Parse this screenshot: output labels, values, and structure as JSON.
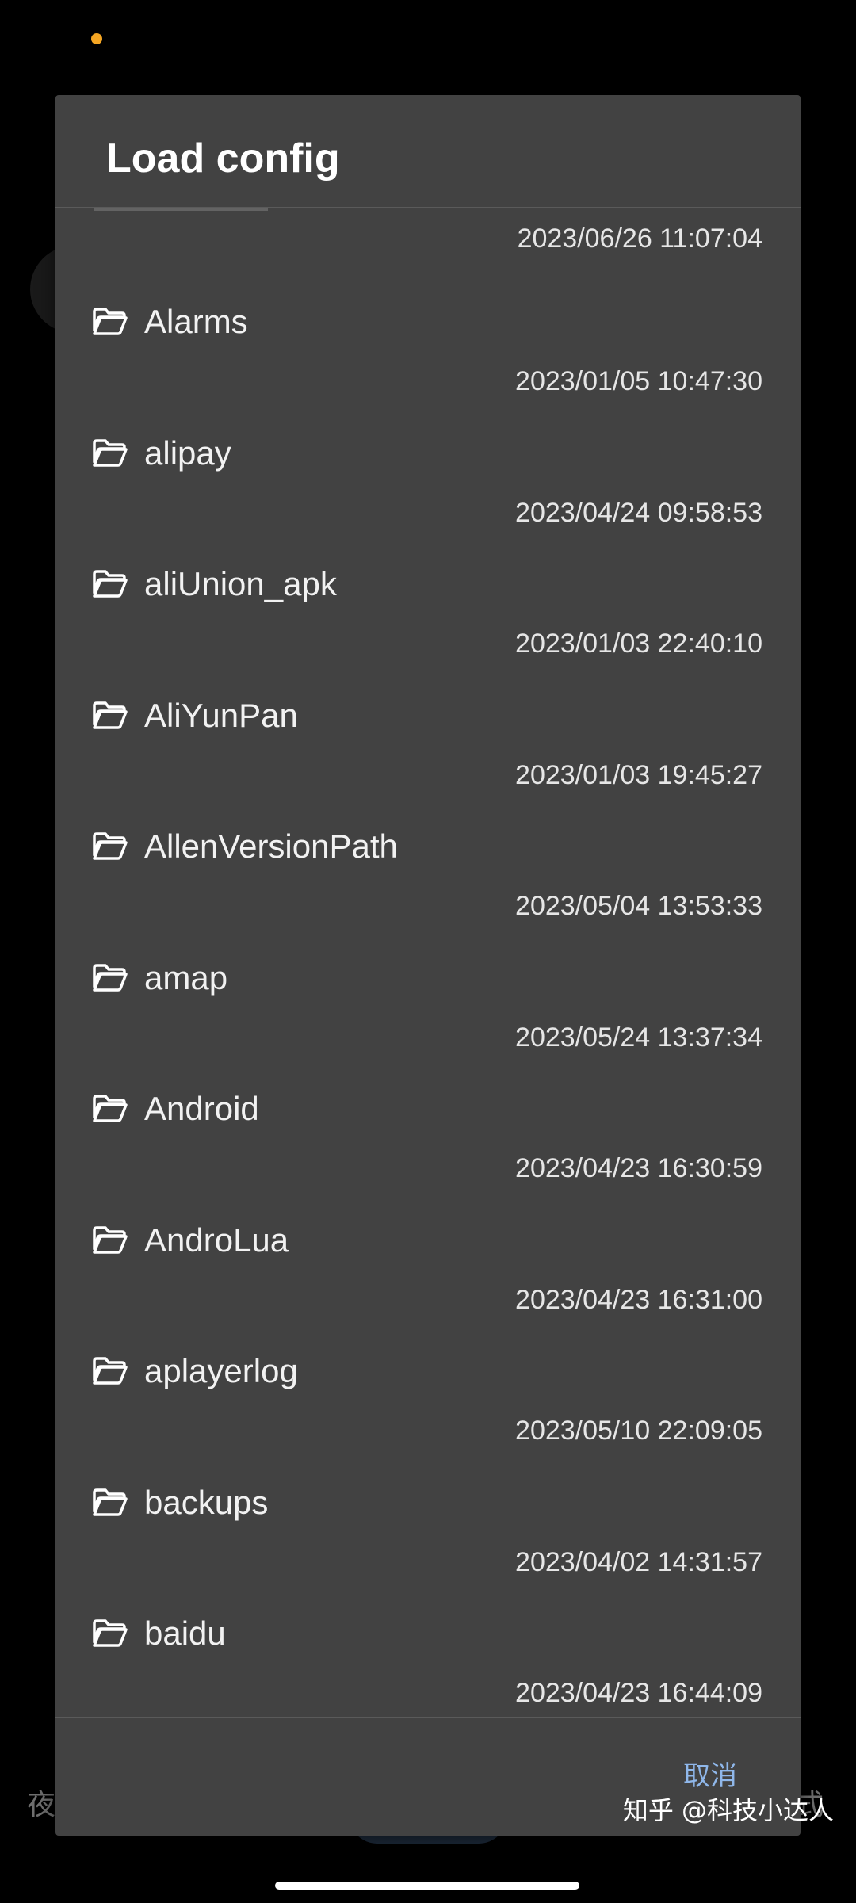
{
  "dialog": {
    "title": "Load config",
    "first_item_date": "2023/06/26 11:07:04",
    "items": [
      {
        "name": "Alarms",
        "date": "2023/01/05 10:47:30"
      },
      {
        "name": "alipay",
        "date": "2023/04/24 09:58:53"
      },
      {
        "name": "aliUnion_apk",
        "date": "2023/01/03 22:40:10"
      },
      {
        "name": "AliYunPan",
        "date": "2023/01/03 19:45:27"
      },
      {
        "name": "AllenVersionPath",
        "date": "2023/05/04 13:53:33"
      },
      {
        "name": "amap",
        "date": "2023/05/24 13:37:34"
      },
      {
        "name": "Android",
        "date": "2023/04/23 16:30:59"
      },
      {
        "name": "AndroLua",
        "date": "2023/04/23 16:31:00"
      },
      {
        "name": "aplayerlog",
        "date": "2023/05/10 22:09:05"
      },
      {
        "name": "backups",
        "date": "2023/04/02 14:31:57"
      },
      {
        "name": "baidu",
        "date": "2023/04/23 16:44:09"
      }
    ],
    "cancel_label": "取消",
    "item_icon": "folder-icon"
  },
  "background": {
    "left_text": "夜",
    "right_text": "式"
  },
  "watermark": "知乎 @科技小达人",
  "colors": {
    "dialog_bg": "#424242",
    "accent": "#8fb7ea",
    "status_dot": "#F5A623"
  }
}
